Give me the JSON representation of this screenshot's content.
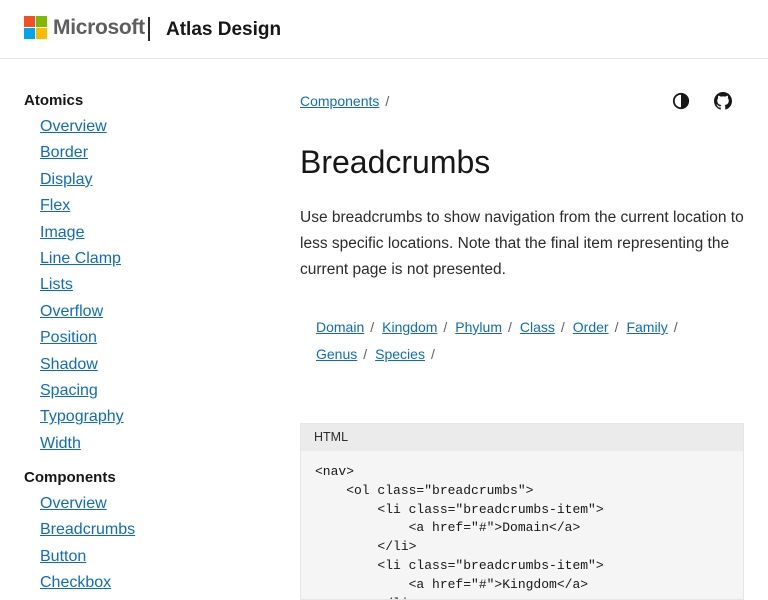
{
  "header": {
    "brand": "Microsoft",
    "site_title": "Atlas Design",
    "logo_colors": [
      "#f25022",
      "#7fba00",
      "#00a4ef",
      "#ffb900"
    ]
  },
  "sidebar": {
    "groups": [
      {
        "title": "Atomics",
        "items": [
          "Overview",
          "Border",
          "Display",
          "Flex",
          "Image",
          "Line Clamp",
          "Lists",
          "Overflow",
          "Position",
          "Shadow",
          "Spacing",
          "Typography",
          "Width"
        ]
      },
      {
        "title": "Components",
        "items": [
          "Overview",
          "Breadcrumbs",
          "Button",
          "Checkbox"
        ]
      }
    ]
  },
  "main": {
    "breadcrumb": {
      "link": "Components",
      "separator": "/"
    },
    "title": "Breadcrumbs",
    "lede": "Use breadcrumbs to show navigation from the current location to less specific locations. Note that the final item representing the current page is not presented.",
    "example_breadcrumbs": [
      "Domain",
      "Kingdom",
      "Phylum",
      "Class",
      "Order",
      "Family",
      "Genus",
      "Species"
    ],
    "separator": "/",
    "code": {
      "language": "HTML",
      "lines": [
        "<nav>",
        "    <ol class=\"breadcrumbs\">",
        "        <li class=\"breadcrumbs-item\">",
        "            <a href=\"#\">Domain</a>",
        "        </li>",
        "        <li class=\"breadcrumbs-item\">",
        "            <a href=\"#\">Kingdom</a>",
        "        </li>"
      ]
    }
  },
  "icons": {
    "theme": "contrast-icon",
    "github": "github-icon"
  },
  "colors": {
    "link": "#0f6cbd",
    "text": "#171717",
    "code_bg": "#f5f5f5",
    "code_header_bg": "#ebebeb"
  }
}
